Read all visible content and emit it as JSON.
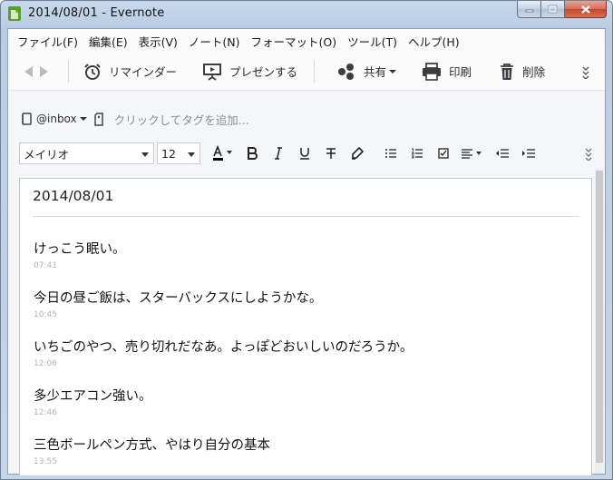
{
  "window": {
    "title": "2014/08/01 - Evernote"
  },
  "menu": [
    {
      "label": "ファイル(F)"
    },
    {
      "label": "編集(E)"
    },
    {
      "label": "表示(V)"
    },
    {
      "label": "ノート(N)"
    },
    {
      "label": "フォーマット(O)"
    },
    {
      "label": "ツール(T)"
    },
    {
      "label": "ヘルプ(H)"
    }
  ],
  "toolbar": {
    "reminder_label": "リマインダー",
    "present_label": "プレゼンする",
    "share_label": "共有",
    "print_label": "印刷",
    "delete_label": "削除"
  },
  "tags": {
    "notebook": "@inbox",
    "placeholder": "クリックしてタグを追加..."
  },
  "format": {
    "font_family": "メイリオ",
    "font_size": "12"
  },
  "note": {
    "title": "2014/08/01",
    "entries": [
      {
        "text": "けっこう眠い。",
        "time": "07:41"
      },
      {
        "text": "今日の昼ご飯は、スターバックスにしようかな。",
        "time": "10:45"
      },
      {
        "text": "いちごのやつ、売り切れだなあ。よっぽどおいしいのだろうか。",
        "time": "12:06"
      },
      {
        "text": "多少エアコン強い。",
        "time": "12:46"
      },
      {
        "text": "三色ボールペン方式、やはり自分の基本",
        "time": "13:55"
      }
    ]
  },
  "colors": {
    "accent_green": "#6fb43f",
    "text_color_swatch": "#000000"
  }
}
